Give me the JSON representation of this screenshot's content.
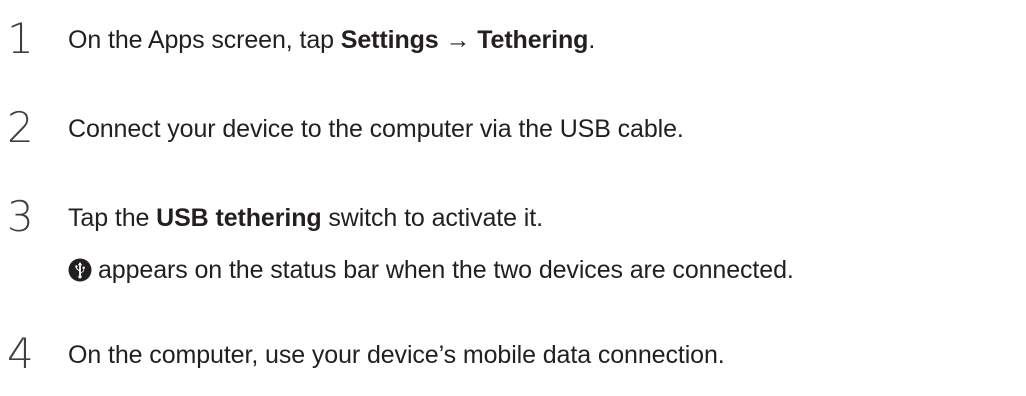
{
  "steps": [
    {
      "number": "1",
      "text_pre": "On the Apps screen, tap ",
      "bold_1": "Settings",
      "arrow": " → ",
      "bold_2": "Tethering",
      "text_post": "."
    },
    {
      "number": "2",
      "text": "Connect your device to the computer via the USB cable."
    },
    {
      "number": "3",
      "text_pre": "Tap the ",
      "bold": "USB tethering",
      "text_post": " switch to activate it.",
      "note_icon": "usb-tethering-status-icon",
      "note": "appears on the status bar when the two devices are connected."
    },
    {
      "number": "4",
      "text": "On the computer, use your device’s mobile data connection."
    }
  ]
}
